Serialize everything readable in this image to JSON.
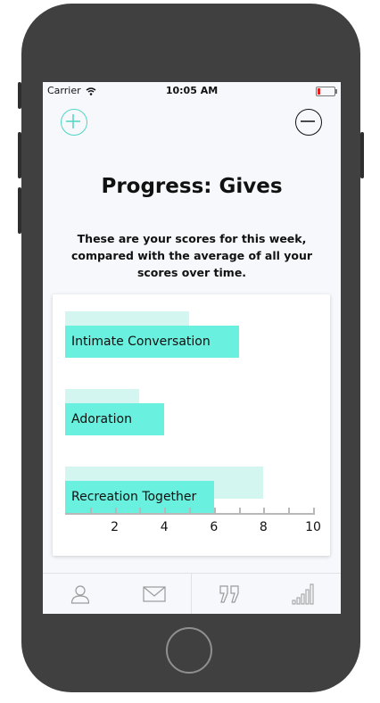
{
  "status_bar": {
    "carrier": "Carrier",
    "time": "10:05 AM"
  },
  "header": {
    "add_icon": "plus-circle-icon",
    "remove_icon": "minus-circle-icon"
  },
  "page": {
    "title": "Progress: Gives",
    "subtitle": "These are your scores for this week, compared with the average of all your scores over time."
  },
  "colors": {
    "current_bar": "#69f0de",
    "average_bar": "#d3f6f1",
    "accent": "#4fd6c4"
  },
  "chart_data": {
    "type": "bar",
    "orientation": "horizontal",
    "categories": [
      "Intimate Conversation",
      "Adoration",
      "Recreation Together"
    ],
    "series": [
      {
        "values": [
          7,
          4,
          6
        ]
      },
      {
        "values": [
          5,
          3,
          8
        ]
      }
    ],
    "xlim": [
      0,
      10
    ],
    "ticks": [
      2,
      4,
      6,
      8,
      10
    ],
    "tick_labels": [
      "2",
      "4",
      "6",
      "8",
      "10"
    ]
  },
  "tabbar": {
    "items": [
      {
        "icon": "person-icon"
      },
      {
        "icon": "mail-icon"
      },
      {
        "icon": "quote-icon"
      },
      {
        "icon": "bar-chart-icon"
      }
    ]
  }
}
